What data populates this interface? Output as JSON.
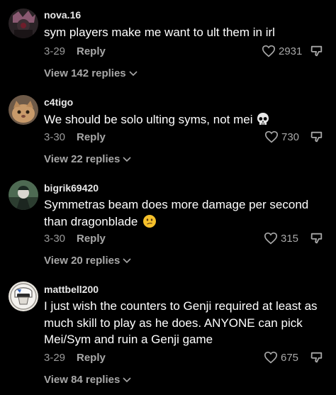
{
  "comments": [
    {
      "username": "nova.16",
      "text": "sym players make me want to ult them in irl",
      "date": "3-29",
      "reply_label": "Reply",
      "likes": "2931",
      "view_replies": "View 142 replies"
    },
    {
      "username": "c4tigo",
      "text": "We should be solo ulting syms, not mei",
      "emoji": "skull",
      "date": "3-30",
      "reply_label": "Reply",
      "likes": "730",
      "view_replies": "View 22 replies"
    },
    {
      "username": "bigrik69420",
      "text_line1": "Symmetras beam does more damage per second",
      "text_line2": "than dragonblade",
      "emoji": "confused-face",
      "date": "3-30",
      "reply_label": "Reply",
      "likes": "315",
      "view_replies": "View 20 replies"
    },
    {
      "username": "mattbell200",
      "text_line1": "I just wish the counters to Genji required at least as",
      "text_line2": "much skill to play as he does. ANYONE can pick",
      "text_line3": "Mei/Sym and ruin a Genji game",
      "date": "3-29",
      "reply_label": "Reply",
      "likes": "675",
      "view_replies": "View 84 replies"
    }
  ],
  "colors": {
    "background": "#000000",
    "muted": "#a8a8a8",
    "text": "#ffffff"
  },
  "icons": [
    "heart-outline-icon",
    "thumbs-down-icon",
    "chevron-down-icon"
  ]
}
